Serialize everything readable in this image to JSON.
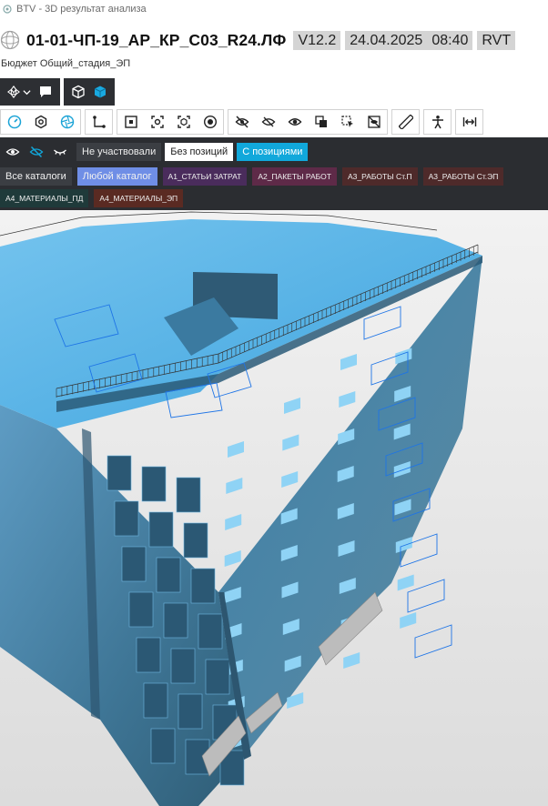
{
  "window": {
    "title": "BTV - 3D результат анализа"
  },
  "header": {
    "project_title": "01-01-ЧП-19_АР_КР_С03_R24.ЛФ",
    "version": "V12.2",
    "date": "24.04.2025",
    "time": "08:40",
    "format": "RVT"
  },
  "subtitle": "Бюджет Общий_стадия_ЭП",
  "toolbar_top": {
    "groups": [
      [
        "orbit-dropdown-icon",
        "comment-icon"
      ],
      [
        "cube-outline-icon",
        "cube-solid-icon"
      ]
    ]
  },
  "toolbar_tools": [
    [
      "speed-gauge-icon",
      "hexagon-settings-icon",
      "aperture-icon"
    ],
    [
      "path-route-icon"
    ],
    [
      "section-box-icon",
      "focus-selection-icon",
      "fit-selection-icon",
      "target-icon"
    ],
    [
      "hide-icon",
      "hide-others-icon",
      "show-icon",
      "isolate-icon",
      "select-icon",
      "unhide-icon"
    ],
    [
      "measure-icon"
    ],
    [
      "walk-person-icon"
    ],
    [
      "expand-width-icon"
    ]
  ],
  "filters": {
    "status_pills": [
      "Не участвовали",
      "Без позиций",
      "С позициями"
    ],
    "catalogs_row1": [
      "Все каталоги",
      "Любой каталог",
      "A1_СТАТЬИ ЗАТРАТ",
      "A2_ПАКЕТЫ РАБОТ",
      "A3_РАБОТЫ Ст.П",
      "A3_РАБОТЫ Ст.ЭП"
    ],
    "catalogs_row2": [
      "A4_МАТЕРИАЛЫ_ПД",
      "A4_МАТЕРИАЛЫ_ЭП"
    ]
  },
  "colors": {
    "toolbar_dark": "#2d2f33",
    "accent_cyan": "#11a8db",
    "accent_blue": "#6f8ee6",
    "model_blue": "#5aa9d6"
  },
  "viewport": {
    "content": "3d-building-model"
  }
}
